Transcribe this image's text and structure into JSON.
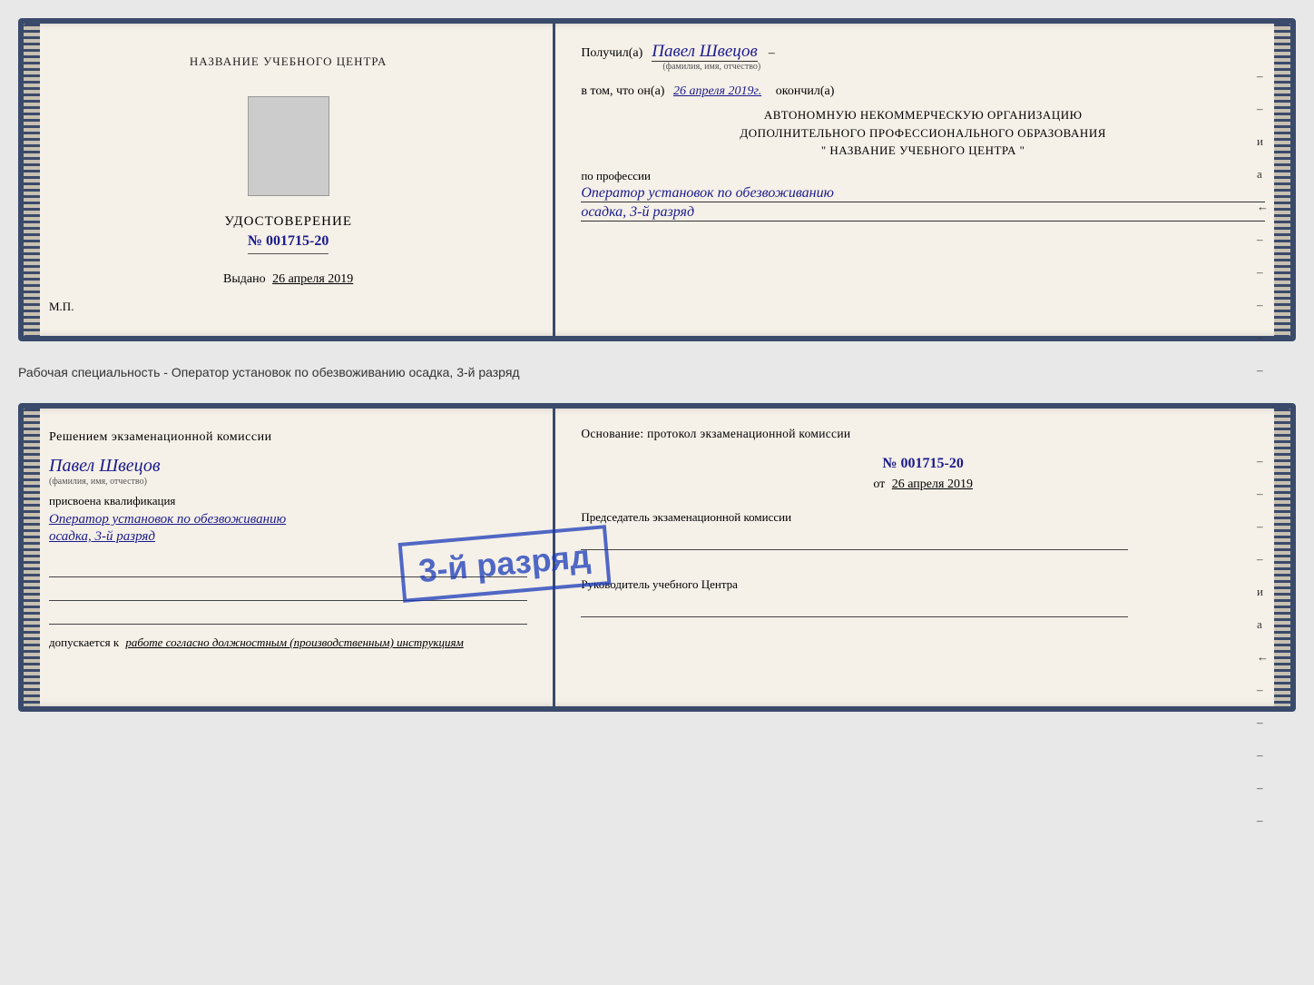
{
  "doc1": {
    "left": {
      "training_center_label": "НАЗВАНИЕ УЧЕБНОГО ЦЕНТРА",
      "udostoverenie_label": "УДОСТОВЕРЕНИЕ",
      "number": "№ 001715-20",
      "vydano_label": "Выдано",
      "vydano_date": "26 апреля 2019",
      "mp_label": "М.П."
    },
    "right": {
      "poluchil_label": "Получил(а)",
      "person_name": "Павел Швецов",
      "fio_sublabel": "(фамилия, имя, отчество)",
      "dash": "–",
      "v_tom_label": "в том, что он(а)",
      "date_value": "26 апреля 2019г.",
      "okonchil_label": "окончил(а)",
      "org_line1": "АВТОНОМНУЮ НЕКОММЕРЧЕСКУЮ ОРГАНИЗАЦИЮ",
      "org_line2": "ДОПОЛНИТЕЛЬНОГО ПРОФЕССИОНАЛЬНОГО ОБРАЗОВАНИЯ",
      "org_line3": "\" НАЗВАНИЕ УЧЕБНОГО ЦЕНТРА \"",
      "po_professii_label": "по профессии",
      "profession1": "Оператор установок по обезвоживанию",
      "profession2": "осадка, 3-й разряд",
      "right_marks": [
        "–",
        "–",
        "и",
        "а",
        "←",
        "–",
        "–",
        "–",
        "–",
        "–"
      ]
    }
  },
  "separator": {
    "text": "Рабочая специальность - Оператор установок по обезвоживанию осадка, 3-й разряд"
  },
  "doc2": {
    "left": {
      "resheniem_label": "Решением экзаменационной комиссии",
      "person_name": "Павел Швецов",
      "fio_sublabel": "(фамилия, имя, отчество)",
      "prisvoena_label": "присвоена квалификация",
      "profession1": "Оператор установок по обезвоживанию",
      "profession2": "осадка, 3-й разряд",
      "dopuskaetsya_label": "допускается к",
      "dopuskaetsya_value": "работе согласно должностным (производственным) инструкциям"
    },
    "right": {
      "osnovanie_label": "Основание: протокол экзаменационной комиссии",
      "number": "№ 001715-20",
      "ot_label": "от",
      "ot_date": "26 апреля 2019",
      "predsedatel_label": "Председатель экзаменационной комиссии",
      "rukovoditel_label": "Руководитель учебного Центра",
      "right_marks": [
        "–",
        "–",
        "–",
        "–",
        "и",
        "а",
        "←",
        "–",
        "–",
        "–",
        "–",
        "–"
      ]
    },
    "stamp": "3-й разряд"
  }
}
